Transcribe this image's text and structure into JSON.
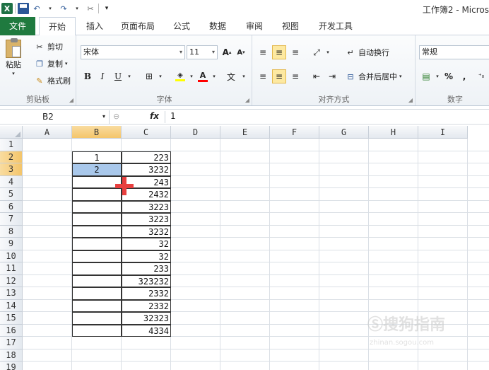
{
  "window": {
    "title": "工作簿2 - Micros"
  },
  "tabs": [
    {
      "label": "文件"
    },
    {
      "label": "开始"
    },
    {
      "label": "插入"
    },
    {
      "label": "页面布局"
    },
    {
      "label": "公式"
    },
    {
      "label": "数据"
    },
    {
      "label": "审阅"
    },
    {
      "label": "视图"
    },
    {
      "label": "开发工具"
    }
  ],
  "ribbon": {
    "clipboard": {
      "paste": "粘贴",
      "cut": "剪切",
      "copy": "复制",
      "format_painter": "格式刷",
      "label": "剪贴板"
    },
    "font": {
      "name": "宋体",
      "size": "11",
      "grow": "A",
      "shrink": "A",
      "bold": "B",
      "italic": "I",
      "underline": "U",
      "phonetic": "文",
      "label": "字体",
      "fill_color": "#ffff00",
      "font_color": "#ff0000"
    },
    "alignment": {
      "wrap": "自动换行",
      "merge": "合并后居中",
      "label": "对齐方式"
    },
    "number": {
      "format": "常规",
      "percent": "%",
      "comma": ",",
      "label": "数字"
    }
  },
  "formula_bar": {
    "name_box": "B2",
    "fx": "fx",
    "value": "1"
  },
  "sheet": {
    "columns": [
      "A",
      "B",
      "C",
      "D",
      "E",
      "F",
      "G",
      "H",
      "I"
    ],
    "rows": [
      "1",
      "2",
      "3",
      "4",
      "5",
      "6",
      "7",
      "8",
      "9",
      "10",
      "11",
      "12",
      "13",
      "14",
      "15",
      "16",
      "17",
      "18",
      "19"
    ],
    "col_b": [
      "1",
      "2"
    ],
    "col_c": [
      "223",
      "3232",
      "243",
      "2432",
      "3223",
      "3223",
      "3232",
      "32",
      "32",
      "233",
      "323232",
      "2332",
      "2332",
      "32323",
      "4334"
    ]
  },
  "watermark": {
    "text": "搜狗指南",
    "url": "zhinan.sogou.com"
  }
}
